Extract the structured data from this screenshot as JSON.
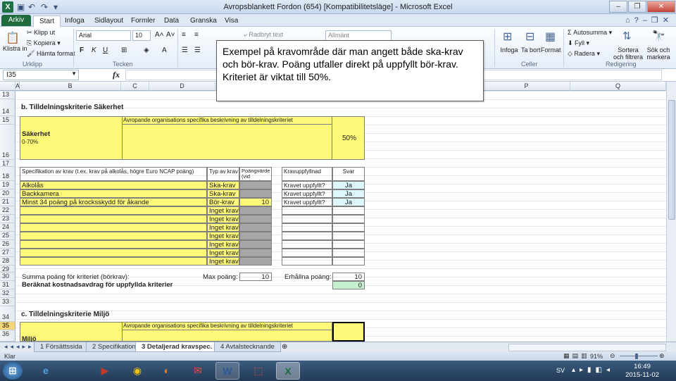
{
  "window": {
    "title": "Avropsblankett Fordon (654)  [Kompatibilitetsläge] - Microsoft Excel",
    "minimize": "–",
    "restore": "❐",
    "close": "✕"
  },
  "tabs": [
    "Arkiv",
    "Start",
    "Infoga",
    "Sidlayout",
    "Formler",
    "Data",
    "Granska",
    "Visa"
  ],
  "ribbon": {
    "clipboard": {
      "paste": "Klistra in",
      "cut": "Klipp ut",
      "copy": "Kopiera",
      "format_painter": "Hämta format",
      "label": "Urklipp"
    },
    "font": {
      "name": "Arial",
      "size": "10",
      "bold": "F",
      "italic": "K",
      "underline": "U",
      "grow": "A˄",
      "shrink": "A˅",
      "label": "Tecken"
    },
    "alignment": {
      "wrap": "Radbryt text"
    },
    "number": {
      "format": "Allmänt"
    },
    "cells": {
      "insert": "Infoga",
      "delete": "Ta bort",
      "format": "Format",
      "label": "Celler"
    },
    "editing": {
      "autosum": "Autosumma",
      "fill": "Fyll",
      "clear": "Radera",
      "sort": "Sortera och filtrera",
      "find": "Sök och markera",
      "label": "Redigering"
    }
  },
  "formula_bar": {
    "name_box": "I35",
    "fx": "fx",
    "formula": ""
  },
  "columns": [
    "A",
    "B",
    "C",
    "D",
    "",
    "P",
    "Q"
  ],
  "rows": [
    "13",
    "14",
    "15",
    "16",
    "17",
    "18",
    "19",
    "20",
    "21",
    "22",
    "23",
    "24",
    "25",
    "26",
    "27",
    "28",
    "29",
    "30",
    "31",
    "32",
    "33",
    "34",
    "35",
    "36"
  ],
  "selected_row": "35",
  "callout": "Exempel på kravområde där man angett både ska-krav och bör-krav. Poäng utfaller direkt på uppfyllt bör-krav. Kriteriet är viktat till 50%.",
  "section_safety": {
    "heading": "b. Tilldelningskriterie Säkerhet",
    "desc_header": "Avropande organisations specifika beskrivning av tilldelningskriteriet",
    "name": "Säkerhet",
    "range": "0-70%",
    "weight": "50%",
    "table_headers": {
      "spec": "Specifikation av krav (t.ex. krav på alkolås, högre Euro NCAP poäng)",
      "type": "Typ av krav",
      "points": "Poängvärde (vid börkrav)",
      "fulfill": "Kravuppfyllnad",
      "answer": "Svar"
    },
    "items": [
      {
        "spec": "Alkolås",
        "type": "Ska-krav",
        "points": "",
        "fulfill": "Kravet uppfyllt?",
        "answer": "Ja"
      },
      {
        "spec": "Backkamera",
        "type": "Ska-krav",
        "points": "",
        "fulfill": "Kravet uppfyllt?",
        "answer": "Ja"
      },
      {
        "spec": "Minst 34 poäng på krocksskydd för åkande",
        "type": "Bör-krav",
        "points": "10",
        "fulfill": "Kravet uppfyllt?",
        "answer": "Ja"
      },
      {
        "spec": "",
        "type": "Inget krav",
        "points": "",
        "fulfill": "",
        "answer": ""
      },
      {
        "spec": "",
        "type": "Inget krav",
        "points": "",
        "fulfill": "",
        "answer": ""
      },
      {
        "spec": "",
        "type": "Inget krav",
        "points": "",
        "fulfill": "",
        "answer": ""
      },
      {
        "spec": "",
        "type": "Inget krav",
        "points": "",
        "fulfill": "",
        "answer": ""
      },
      {
        "spec": "",
        "type": "Inget krav",
        "points": "",
        "fulfill": "",
        "answer": ""
      },
      {
        "spec": "",
        "type": "Inget krav",
        "points": "",
        "fulfill": "",
        "answer": ""
      },
      {
        "spec": "",
        "type": "Inget krav",
        "points": "",
        "fulfill": "",
        "answer": ""
      }
    ],
    "sum_label": "Summa poäng för kriteriet (börkrav):",
    "max_label": "Max poäng:",
    "max_value": "10",
    "got_label": "Erhållna poäng:",
    "got_value": "10",
    "deduction_label": "Beräknat kostnadsavdrag för uppfyllda kriterier",
    "deduction_value": "0"
  },
  "section_env": {
    "heading": "c. Tilldelningskriterie Miljö",
    "desc_header": "Avropande organisations specifika beskrivning av tilldelningskriteriet",
    "name": "Miljö"
  },
  "sheets": [
    "1 Försättssida",
    "2 Specifikation",
    "3 Detaljerad kravspec.",
    "4 Avtalstecknande"
  ],
  "active_sheet": "3 Detaljerad kravspec.",
  "status": {
    "mode": "Klar",
    "zoom": "91%"
  },
  "taskbar": {
    "lang": "SV",
    "time": "16:49",
    "date": "2015-11-02"
  },
  "colors": {
    "yellow": "#fff97a",
    "gray": "#a6a6a6",
    "cyan": "#ddf7fb",
    "green": "#c6efce",
    "excel_green": "#1f6b3d"
  }
}
